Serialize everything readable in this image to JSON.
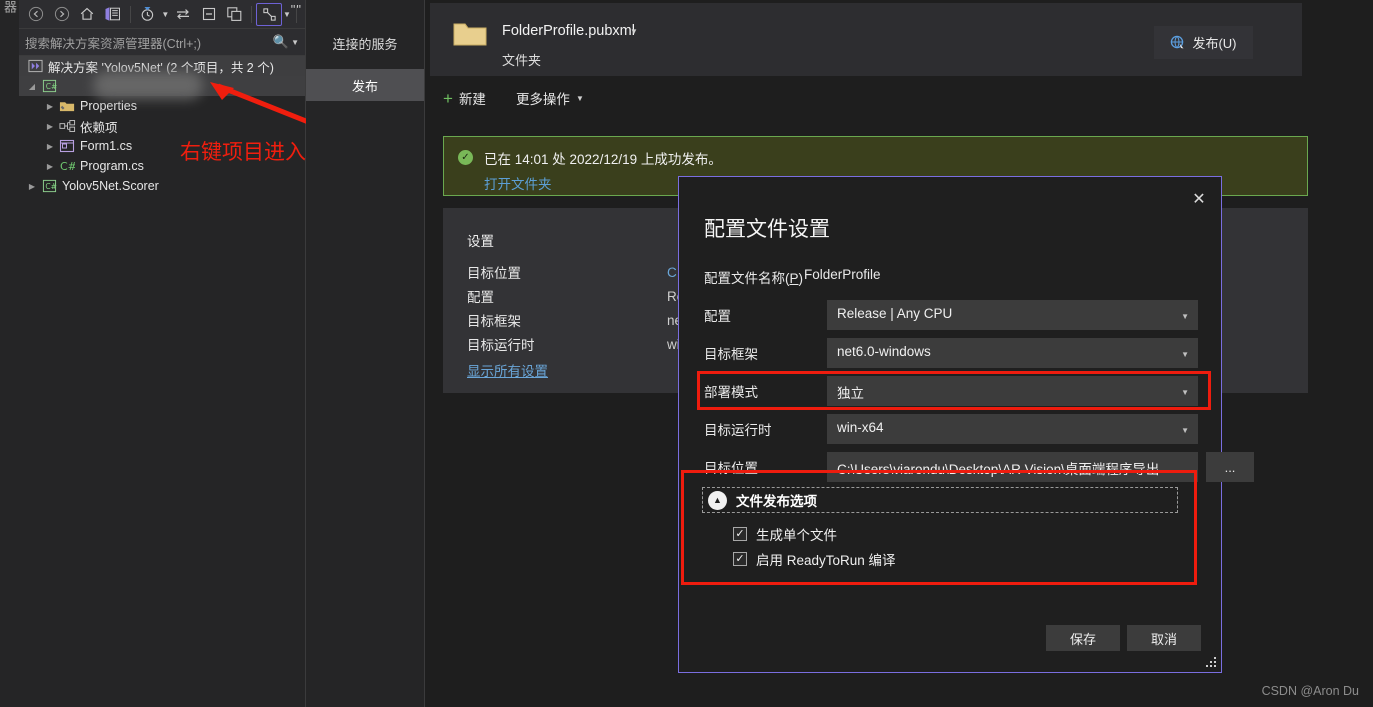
{
  "left_strip": {
    "vertical_label": "器"
  },
  "solution_explorer": {
    "toolbar": {
      "back_icon": "back-arrow-icon",
      "forward_icon": "forward-arrow-icon",
      "home_icon": "home-icon",
      "solution_icon": "solution-explorer-icon",
      "pending_changes_icon": "pending-changes-clock-icon",
      "sync_icon": "sync-with-active-document-icon",
      "collapse_icon": "collapse-all-icon",
      "properties_icon": "show-all-files-icon",
      "view_icon": "switch-views-icon",
      "overflow_label": "\"\""
    },
    "search": {
      "placeholder": "搜索解决方案资源管理器(Ctrl+;)",
      "magnifier_icon": "search-icon",
      "caret_icon": "chevron-down-icon"
    },
    "tree": {
      "root": "解决方案 'Yolov5Net' (2 个项目，共 2 个)",
      "project_name_redacted": "",
      "items": [
        {
          "label": "Properties",
          "icon": "properties-folder-icon",
          "level": 2
        },
        {
          "label": "依赖项",
          "icon": "dependencies-icon",
          "level": 2
        },
        {
          "label": "Form1.cs",
          "icon": "form-icon",
          "level": 2
        },
        {
          "label": "Program.cs",
          "icon": "csharp-file-icon",
          "level": 2
        },
        {
          "label": "Yolov5Net.Scorer",
          "icon": "csharp-project-icon",
          "level": 1
        }
      ]
    }
  },
  "annotation": {
    "text": "右键项目进入发布设置",
    "color": "#f01e0e",
    "arrow_icon": "red-arrow-icon"
  },
  "publish_tabs": {
    "items": [
      {
        "label": "连接的服务",
        "active": false
      },
      {
        "label": "发布",
        "active": true
      }
    ]
  },
  "publish_main": {
    "profile": {
      "folder_icon": "folder-icon",
      "name": "FolderProfile.pubxml",
      "caret_icon": "chevron-down-icon",
      "subtitle": "文件夹"
    },
    "publish_button": {
      "label": "发布(U)",
      "icon": "publish-globe-icon"
    },
    "actions": [
      {
        "label": "新建",
        "icon": "plus-icon"
      },
      {
        "label": "更多操作",
        "icon": "chevron-down-icon"
      }
    ],
    "banner": {
      "status_icon": "success-check-icon",
      "message": "已在 14:01 处 2022/12/19 上成功发布。",
      "link": "打开文件夹",
      "border_color": "#6aa84f",
      "background_color": "#3a3f1c"
    },
    "settings": {
      "title": "设置",
      "rows": [
        {
          "key": "目标位置",
          "value": "C:\\",
          "is_link": true
        },
        {
          "key": "配置",
          "value": "Re",
          "is_link": false
        },
        {
          "key": "目标框架",
          "value": "net",
          "is_link": false
        },
        {
          "key": "目标运行时",
          "value": "wir",
          "is_link": false
        }
      ],
      "show_all": "显示所有设置"
    }
  },
  "dialog": {
    "title": "配置文件设置",
    "close_icon": "close-icon",
    "profile_name_label": "配置文件名称(P)",
    "profile_name_underlined": "P",
    "profile_name_value": "FolderProfile",
    "fields": [
      {
        "key": "配置",
        "value": "Release | Any CPU",
        "caret_icon": "chevron-down-icon",
        "highlighted": false
      },
      {
        "key": "目标框架",
        "value": "net6.0-windows",
        "caret_icon": "chevron-down-icon",
        "highlighted": false
      },
      {
        "key": "部署模式",
        "value": "独立",
        "caret_icon": "chevron-down-icon",
        "highlighted": true
      },
      {
        "key": "目标运行时",
        "value": "win-x64",
        "caret_icon": "chevron-down-icon",
        "highlighted": false
      }
    ],
    "location_field": {
      "key": "目标位置",
      "value": "C:\\Users\\viarondu\\Desktop\\AR Vision\\桌面端程序导出",
      "browse_label": "..."
    },
    "file_publish_options": {
      "collapse_icon": "chevron-up-circle-icon",
      "title": "文件发布选项",
      "checkboxes": [
        {
          "label": "生成单个文件",
          "checked": true
        },
        {
          "label": "启用 ReadyToRun 编译",
          "checked": true
        }
      ]
    },
    "buttons": [
      {
        "label": "保存",
        "name": "save-button"
      },
      {
        "label": "取消",
        "name": "cancel-button"
      }
    ],
    "resize_grip_icon": "resize-grip-icon",
    "highlight_color": "#ee1c0e",
    "border_color": "#7a6ee0"
  },
  "watermark": "CSDN @Aron Du"
}
